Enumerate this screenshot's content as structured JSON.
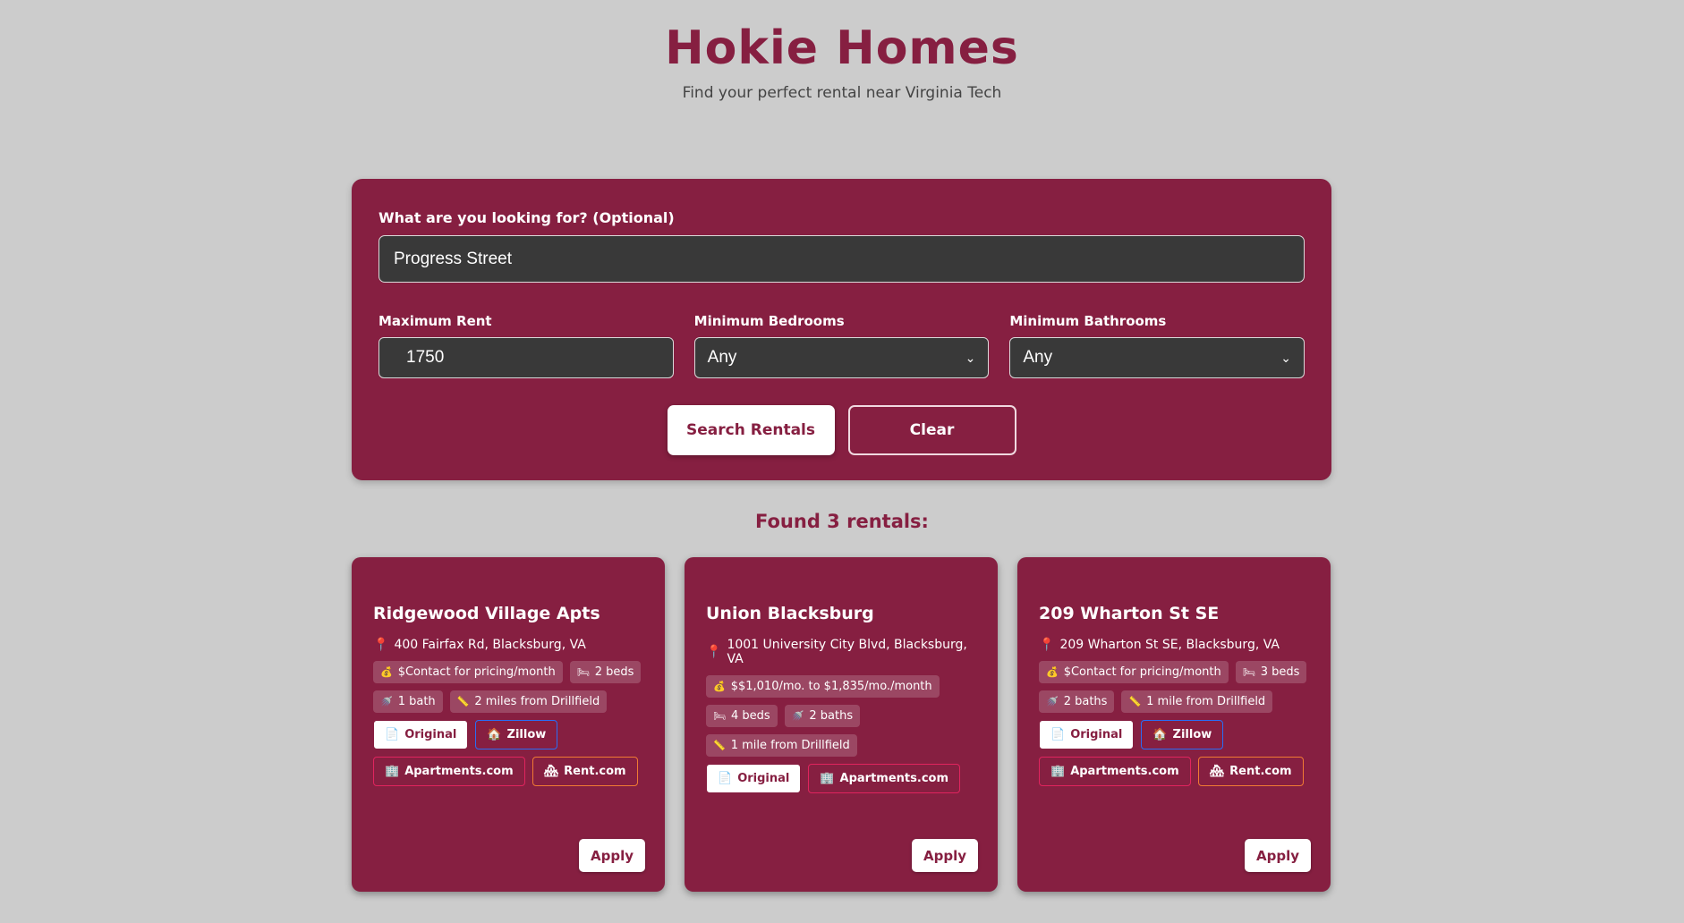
{
  "header": {
    "title": "Hokie Homes",
    "subtitle": "Find your perfect rental near Virginia Tech"
  },
  "search": {
    "query_label": "What are you looking for? (Optional)",
    "query_value": "Progress Street",
    "max_rent_label": "Maximum Rent",
    "max_rent_value": "1750",
    "min_bedrooms_label": "Minimum Bedrooms",
    "min_bedrooms_value": "Any",
    "min_bathrooms_label": "Minimum Bathrooms",
    "min_bathrooms_value": "Any",
    "search_button": "Search Rentals",
    "clear_button": "Clear"
  },
  "results": {
    "count_text": "Found 3 rentals:",
    "apply_label": "Apply",
    "link_labels": {
      "original": "Original",
      "zillow": "Zillow",
      "apartments": "Apartments.com",
      "rent": "Rent.com"
    },
    "cards": [
      {
        "title": "Ridgewood Village Apts",
        "address": "400 Fairfax Rd, Blacksburg, VA",
        "price": "$Contact for pricing/month",
        "beds": "2 beds",
        "baths": "1 bath",
        "distance": "2 miles from Drillfield"
      },
      {
        "title": "Union Blacksburg",
        "address": "1001 University City Blvd, Blacksburg, VA",
        "price": "$$1,010/mo. to $1,835/mo./month",
        "beds": "4 beds",
        "baths": "2 baths",
        "distance": "1 mile from Drillfield"
      },
      {
        "title": "209 Wharton St SE",
        "address": "209 Wharton St SE, Blacksburg, VA",
        "price": "$Contact for pricing/month",
        "beds": "3 beds",
        "baths": "2 baths",
        "distance": "1 mile from Drillfield"
      }
    ]
  },
  "colors": {
    "brand": "#861f41",
    "background": "#cccccc"
  }
}
